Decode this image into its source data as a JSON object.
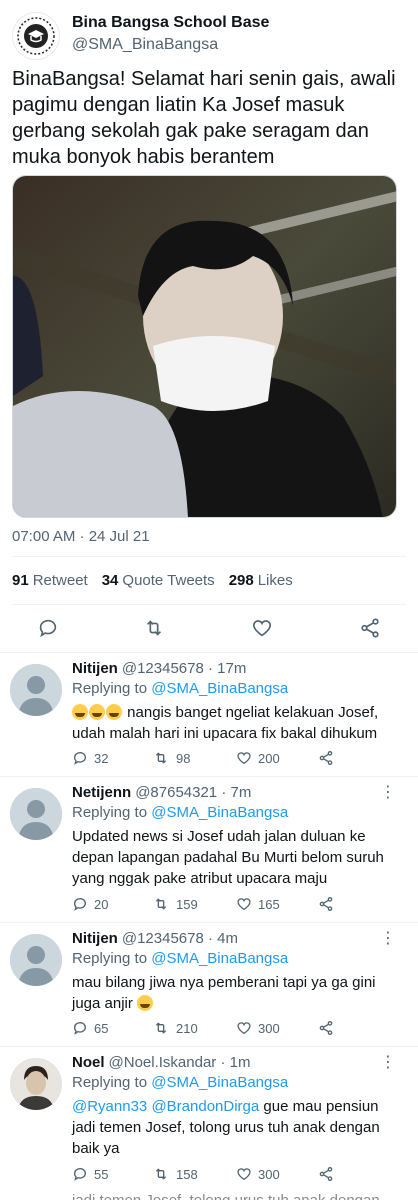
{
  "tweet": {
    "display_name": "Bina Bangsa School Base",
    "handle": "@SMA_BinaBangsa",
    "text": "BinaBangsa! Selamat hari senin gais, awali pagimu dengan liatin Ka Josef masuk gerbang sekolah gak pake seragam dan muka bonyok habis berantem",
    "timestamp": "07:00 AM · 24 Jul 21",
    "stats": {
      "retweets": "91",
      "retweets_label": "Retweet",
      "quotes": "34",
      "quotes_label": "Quote Tweets",
      "likes": "298",
      "likes_label": "Likes"
    }
  },
  "replies": [
    {
      "name": "Nitijen",
      "handle": "@12345678",
      "time": "· 17m",
      "replying_label": "Replying to",
      "replying_to": "@SMA_BinaBangsa",
      "text": "nangis banget ngeliat kelakuan Josef, udah malah hari ini upacara fix bakal dihukum",
      "retweets": "98",
      "likes": "200"
    },
    {
      "name": "Netijenn",
      "handle": "@87654321",
      "time": "· 7m",
      "replying_label": "Replying to",
      "replying_to": "@SMA_BinaBangsa",
      "text": "Updated news si Josef udah jalan duluan ke depan lapangan padahal Bu Murti belom suruh yang nggak pake atribut upacara maju",
      "replies": "20",
      "retweets": "159",
      "likes": "165"
    },
    {
      "name": "Nitijen",
      "handle": "@12345678",
      "time": "· 4m",
      "replying_label": "Replying to",
      "replying_to": "@SMA_BinaBangsa",
      "text": "mau bilang jiwa nya pemberani tapi ya ga gini juga anjir",
      "replies": "65",
      "retweets": "210",
      "likes": "300"
    },
    {
      "name": "Noel",
      "handle": "@Noel.Iskandar",
      "time": "· 1m",
      "replying_label": "Replying to",
      "replying_to": "@SMA_BinaBangsa",
      "mention1": "@Ryann33",
      "mention2": "@BrandonDirga",
      "text": "gue mau pensiun jadi temen Josef, tolong urus tuh anak dengan baik ya",
      "replies": "55",
      "retweets": "158",
      "likes": "300"
    }
  ],
  "first_reply_count": "32",
  "cut_text": "jadi temen Josef, tolong urus tuh anak dengan",
  "colors": {
    "accent": "#1d9bf0",
    "muted": "#536471",
    "text": "#0f1419",
    "divider": "#eff3f4"
  },
  "icons": [
    "school-logo-icon",
    "reply-icon",
    "retweet-icon",
    "like-icon",
    "share-icon",
    "more-icon",
    "default-avatar-icon",
    "crying-emoji-icon"
  ]
}
